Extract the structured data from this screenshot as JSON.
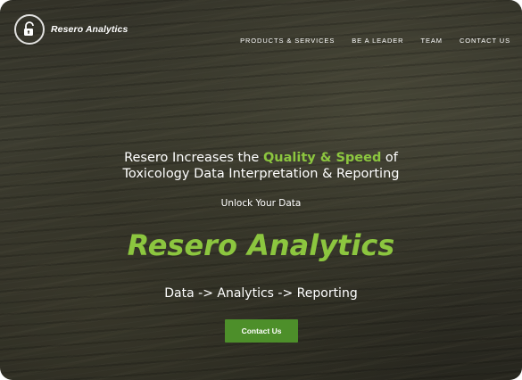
{
  "header": {
    "logo_text": "Resero Analytics",
    "logo_icon": "open-padlock-icon",
    "nav": [
      {
        "label": "PRODUCTS & SERVICES"
      },
      {
        "label": "BE A LEADER"
      },
      {
        "label": "TEAM"
      },
      {
        "label": "CONTACT US"
      }
    ]
  },
  "hero": {
    "headline_part1": "Resero Increases the ",
    "headline_highlight": "Quality & Speed",
    "headline_part2": " of",
    "headline_line2": "Toxicology Data Interpretation & Reporting",
    "tagline": "Unlock Your Data",
    "brand": "Resero Analytics",
    "subline": "Data -> Analytics -> Reporting",
    "cta_label": "Contact Us"
  },
  "colors": {
    "accent_green": "#8cc63f",
    "button_green": "#4d8f2a",
    "text": "#ffffff"
  }
}
